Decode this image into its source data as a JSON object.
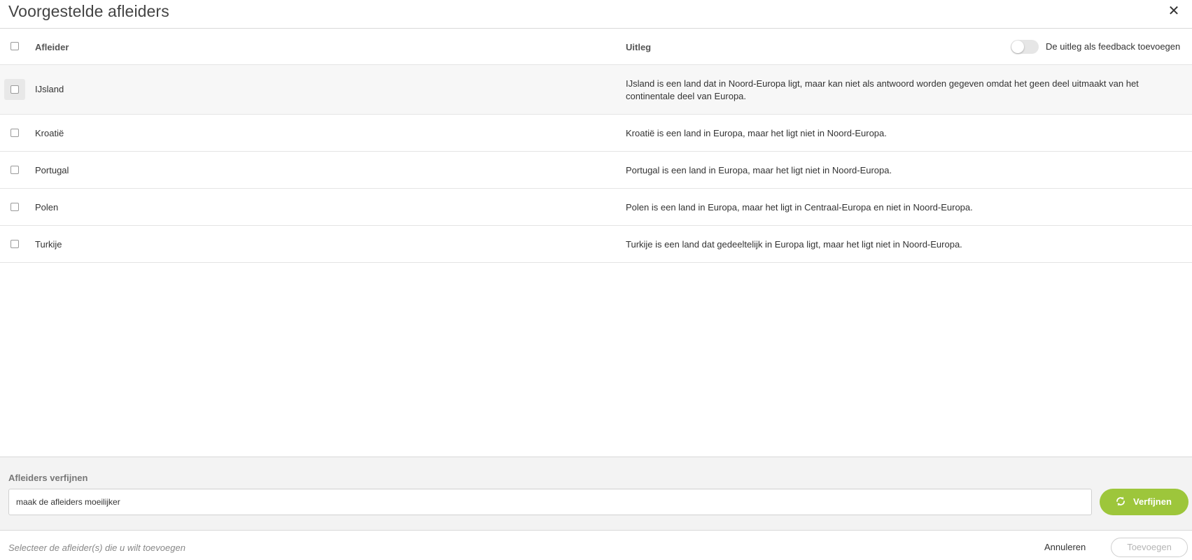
{
  "dialog": {
    "title": "Voorgestelde afleiders",
    "close_icon": "close-icon"
  },
  "table": {
    "headers": {
      "distractor": "Afleider",
      "explanation": "Uitleg"
    },
    "feedback_toggle": {
      "label": "De uitleg als feedback toevoegen",
      "on": false
    },
    "rows": [
      {
        "name": "IJsland",
        "explanation": "IJsland is een land dat in Noord-Europa ligt, maar kan niet als antwoord worden gegeven omdat het geen deel uitmaakt van het continentale deel van Europa."
      },
      {
        "name": "Kroatië",
        "explanation": "Kroatië is een land in Europa, maar het ligt niet in Noord-Europa."
      },
      {
        "name": "Portugal",
        "explanation": "Portugal is een land in Europa, maar het ligt niet in Noord-Europa."
      },
      {
        "name": "Polen",
        "explanation": "Polen is een land in Europa, maar het ligt in Centraal-Europa en niet in Noord-Europa."
      },
      {
        "name": "Turkije",
        "explanation": "Turkije is een land dat gedeeltelijk in Europa ligt, maar het ligt niet in Noord-Europa."
      }
    ]
  },
  "refine": {
    "label": "Afleiders verfijnen",
    "input_value": "maak de afleiders moeilijker",
    "button_label": "Verfijnen",
    "button_color": "#9dc63b",
    "button_icon": "refresh-icon"
  },
  "footer": {
    "hint": "Selecteer de afleider(s) die u wilt toevoegen",
    "cancel_label": "Annuleren",
    "add_label": "Toevoegen"
  }
}
